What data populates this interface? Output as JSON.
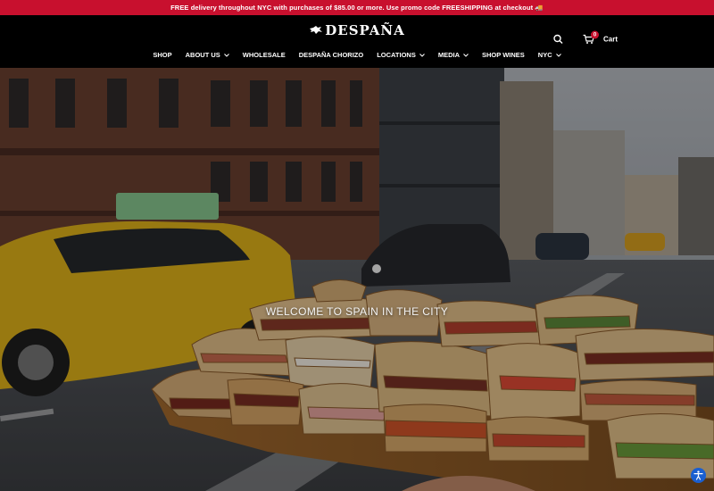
{
  "announcement": {
    "text": "FREE delivery throughout NYC with purchases of $85.00 or more. Use promo code FREESHIPPING at checkout 🚚"
  },
  "header": {
    "logo_text": "DESPAÑA",
    "cart_label": "Cart",
    "cart_count": "0"
  },
  "nav": {
    "shop": "SHOP",
    "about": "ABOUT US",
    "wholesale": "WHOLESALE",
    "chorizo": "DESPAÑA CHORIZO",
    "locations": "LOCATIONS",
    "media": "MEDIA",
    "wines": "SHOP WINES",
    "nyc": "NYC"
  },
  "hero": {
    "title": "WELCOME TO SPAIN IN THE CITY"
  },
  "icons": {
    "search": "search-icon",
    "cart": "cart-icon",
    "chevron": "chevron-down-icon",
    "accessibility": "accessibility-icon"
  },
  "colors": {
    "announcement_bg": "#c8102e",
    "header_bg": "#000000",
    "accessibility_button": "#1a5fd0"
  }
}
